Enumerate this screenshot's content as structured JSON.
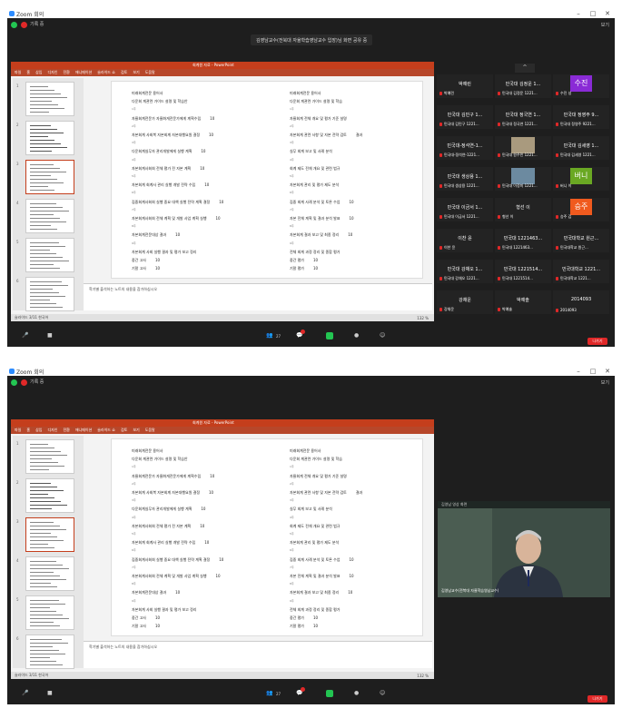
{
  "app": {
    "title": "Zoom 회의",
    "record_label": "기록 중",
    "view_label": "보기",
    "share_banner": "김영남교수(전북대 자율학습영남교수 입장)님 화면 공유 중",
    "window_controls": [
      "–",
      "□",
      "✕"
    ]
  },
  "ppt": {
    "titlebar_text": "회계원 자료 - PowerPoint",
    "ribbon_tabs": [
      "파일",
      "홈",
      "삽입",
      "디자인",
      "전환",
      "애니메이션",
      "슬라이드 쇼",
      "검토",
      "보기",
      "도움말"
    ],
    "slide_numbers": [
      "1",
      "2",
      "3",
      "4",
      "5",
      "6",
      "7"
    ],
    "slide_left": [
      {
        "text": "미래회계전문 용어사",
        "score": ""
      },
      {
        "text": "다운회 계관련 가이드 설명 및 학습안",
        "score": ""
      },
      {
        "text": "1주",
        "score": ""
      },
      {
        "text": "자율회계전문가 자율화게전문가에게 계획수립",
        "score": "10"
      },
      {
        "text": "2주",
        "score": ""
      },
      {
        "text": "자본회계 사회복 자본회계 자본대행요원 결정",
        "score": "10"
      },
      {
        "text": "3주",
        "score": ""
      },
      {
        "text": "다운회계실무자 관리개발에게 실행 계획",
        "score": "10"
      },
      {
        "text": "4주",
        "score": ""
      },
      {
        "text": "자본회계사회회 전체 평가 전 자본 계획",
        "score": "10"
      },
      {
        "text": "5주",
        "score": ""
      },
      {
        "text": "자본회계 회계사 관리 실행 개발 전략 수립",
        "score": "10"
      },
      {
        "text": "6주",
        "score": ""
      },
      {
        "text": "집중회계사회회 실행 중요 대책 실행 전략 계획 결정",
        "score": "10"
      },
      {
        "text": "7주",
        "score": ""
      },
      {
        "text": "자본회계사회회 전체 계획 및 개발 사업 계획 실행",
        "score": "10"
      },
      {
        "text": "8주",
        "score": ""
      },
      {
        "text": "자본회계전문대상 결과",
        "score": "10"
      },
      {
        "text": "9주",
        "score": ""
      },
      {
        "text": "자본회계 사회 실행 결과 및 평가 보고 정리",
        "score": ""
      },
      {
        "text": "중간 고사",
        "score": "10"
      },
      {
        "text": "기말 고사",
        "score": "10"
      }
    ],
    "slide_right": [
      {
        "text": "미래회계전문 용어사",
        "score": ""
      },
      {
        "text": "다운회 계관련 가이드 설명 및 학습",
        "score": ""
      },
      {
        "text": "1주",
        "score": ""
      },
      {
        "text": "자율회계 전체 개요 및 평가 기준 설명",
        "score": ""
      },
      {
        "text": "2주",
        "score": ""
      },
      {
        "text": "자본회계 관련 사항 및 자본 전략 검토",
        "score": "결과"
      },
      {
        "text": "3주",
        "score": ""
      },
      {
        "text": "실무 회계 보고 및 사례 분석",
        "score": ""
      },
      {
        "text": "4주",
        "score": ""
      },
      {
        "text": "회계 제도 전체 개요 및 관련 법규",
        "score": ""
      },
      {
        "text": "5주",
        "score": ""
      },
      {
        "text": "자본회계 관리 및 평가 제도 분석",
        "score": ""
      },
      {
        "text": "6주",
        "score": ""
      },
      {
        "text": "집중 회계 사례 분석 및 토론 수업",
        "score": "10"
      },
      {
        "text": "7주",
        "score": ""
      },
      {
        "text": "자본 전체 계획 및 결과 분석 발표",
        "score": "10"
      },
      {
        "text": "8주",
        "score": ""
      },
      {
        "text": "자본회계 결과 보고 및 최종 정리",
        "score": "10"
      },
      {
        "text": "9주",
        "score": ""
      },
      {
        "text": "전체 회계 과정 정리 및 종합 평가",
        "score": ""
      },
      {
        "text": "중간 평가",
        "score": "10"
      },
      {
        "text": "기말 평가",
        "score": "10"
      }
    ],
    "notes_text": "학기별 출석하는 노트의 내용을 참가하십시오",
    "status_left": "슬라이드 3/11  한국어",
    "status_zoom": "132 %"
  },
  "gallery": {
    "tiles": [
      {
        "label": "박예린",
        "name": "박예린",
        "avatar": ""
      },
      {
        "label": "민국대 김정운 1...",
        "name": "민국대 김정운 1221...",
        "avatar": ""
      },
      {
        "label": "",
        "name": "수진 성",
        "avatar": "수진",
        "color": "#8a2bd6"
      },
      {
        "label": "민국대 김민구 1...",
        "name": "민국대 김민구 1221...",
        "avatar": ""
      },
      {
        "label": "민국대 정국연 1...",
        "name": "민국대 정국연 1221...",
        "avatar": ""
      },
      {
        "label": "민국대 정영주 9...",
        "name": "민국대 정영주 9221...",
        "avatar": ""
      },
      {
        "label": "민국대-정석연-1...",
        "name": "민국대-정석연-1221...",
        "avatar": ""
      },
      {
        "label": "",
        "name": "민국대 원주민 1221...",
        "avatar": "",
        "photo": "#a99a7e"
      },
      {
        "label": "민국대 김세영 1...",
        "name": "민국대 김세영 1221...",
        "avatar": ""
      },
      {
        "label": "민국대 생상용 1...",
        "name": "민국대 생상용 1221...",
        "avatar": ""
      },
      {
        "label": "",
        "name": "민국대 이정미 1221...",
        "avatar": "",
        "photo": "#6c8aa0"
      },
      {
        "label": "",
        "name": "버니 이",
        "avatar": "버니",
        "color": "#6aa823"
      },
      {
        "label": "민국대 이금서 1...",
        "name": "민국대 이금서 1221...",
        "avatar": ""
      },
      {
        "label": "형선 이",
        "name": "형선 이",
        "avatar": ""
      },
      {
        "label": "",
        "name": "승주 김",
        "avatar": "승주",
        "color": "#f05a1e"
      },
      {
        "label": "이찬 윤",
        "name": "이찬 윤",
        "avatar": ""
      },
      {
        "label": "민국대 1221463...",
        "name": "민국대 1221463...",
        "avatar": ""
      },
      {
        "label": "민국대학교 원근...",
        "name": "민국대학교 원근...",
        "avatar": ""
      },
      {
        "label": "민국대 강채오 1...",
        "name": "민국대 강채오 1221...",
        "avatar": ""
      },
      {
        "label": "민국대 1221514...",
        "name": "민국대 1221514...",
        "avatar": ""
      },
      {
        "label": "민국대학교 1221...",
        "name": "민국대학교 1221...",
        "avatar": ""
      },
      {
        "label": "강채운",
        "name": "강채운",
        "avatar": ""
      },
      {
        "label": "박예솔",
        "name": "박예솔",
        "avatar": ""
      },
      {
        "label": "2014093",
        "name": "2014093",
        "avatar": ""
      }
    ]
  },
  "controls": {
    "mute": "🎤",
    "video": "■",
    "participants": "👥",
    "participants_count": "27",
    "chat": "💬",
    "share": "▲",
    "record": "●",
    "reactions": "☺",
    "end": "나가기"
  },
  "video_window": {
    "title": "김영남 영상 화면",
    "speaker_name": "김영남교수(전북대 자율학습영남교수)"
  }
}
